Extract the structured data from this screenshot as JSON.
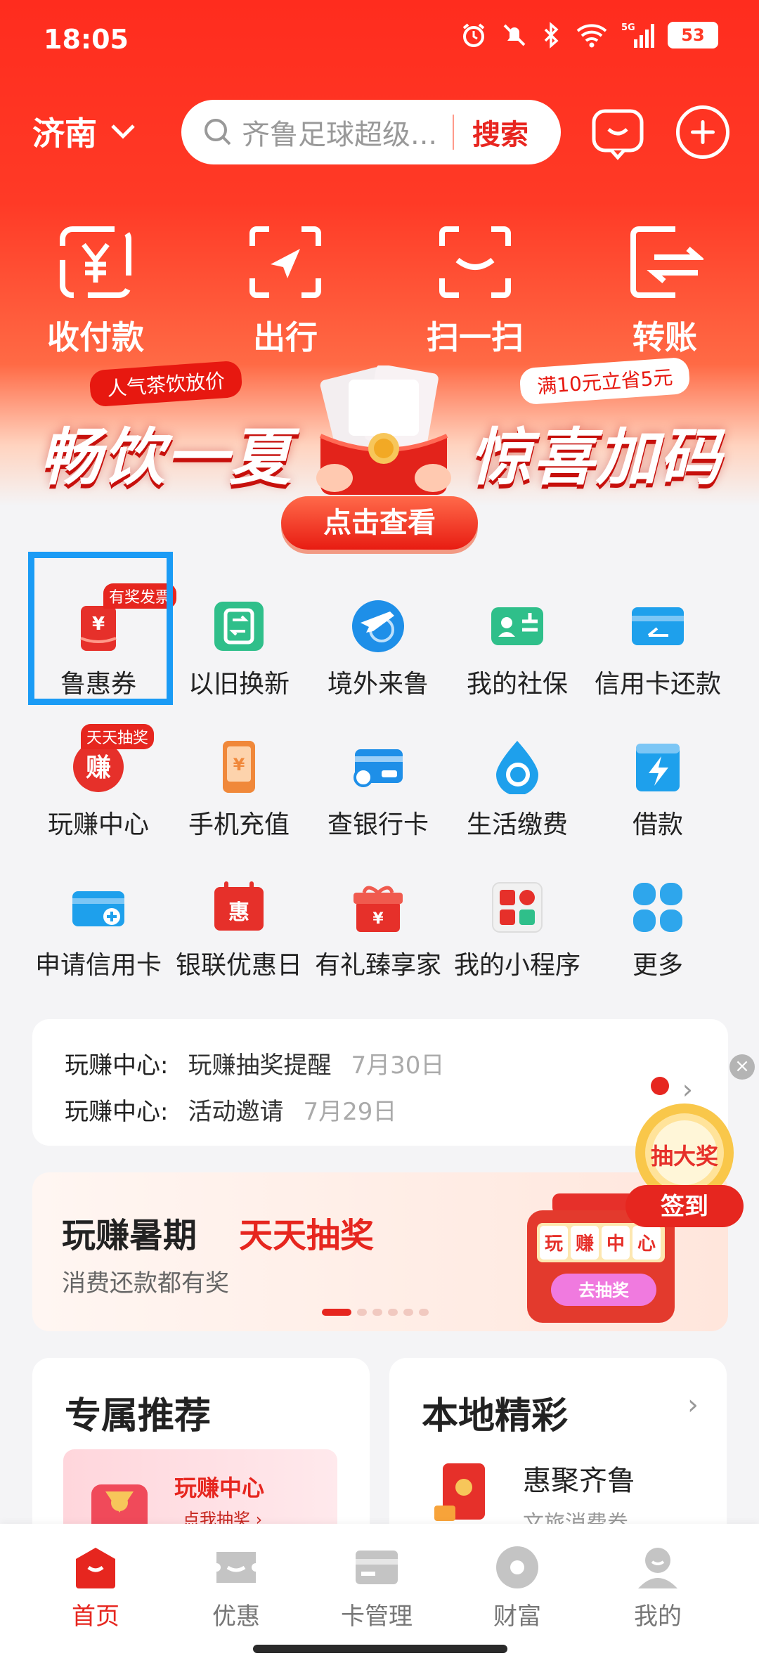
{
  "status_bar": {
    "time": "18:05",
    "network": "5G",
    "battery": "53"
  },
  "header": {
    "city": "济南",
    "search_placeholder": "齐鲁足球超级...",
    "search_button": "搜索"
  },
  "quick_actions": [
    {
      "label": "收付款",
      "icon": "yuan-scan-icon"
    },
    {
      "label": "出行",
      "icon": "navigation-arrow-icon"
    },
    {
      "label": "扫一扫",
      "icon": "scan-icon"
    },
    {
      "label": "转账",
      "icon": "transfer-icon"
    }
  ],
  "banner": {
    "tag_left": "人气茶饮放价",
    "title_left": "畅饮一夏",
    "tag_right": "满10元立省5元",
    "title_right": "惊喜加码",
    "cta": "点击查看"
  },
  "services": [
    {
      "label": "鲁惠券",
      "badge": "有奖发票",
      "icon": "coupon-icon",
      "color": "#e6302a"
    },
    {
      "label": "以旧换新",
      "badge": "",
      "icon": "exchange-icon",
      "color": "#2fbf8a"
    },
    {
      "label": "境外来鲁",
      "badge": "",
      "icon": "plane-globe-icon",
      "color": "#1e8fe8"
    },
    {
      "label": "我的社保",
      "badge": "",
      "icon": "id-card-icon",
      "color": "#2fbf8a"
    },
    {
      "label": "信用卡还款",
      "badge": "",
      "icon": "credit-card-icon",
      "color": "#1ea0ec"
    },
    {
      "label": "玩赚中心",
      "badge": "天天抽奖",
      "icon": "earn-icon",
      "color": "#e6302a"
    },
    {
      "label": "手机充值",
      "badge": "",
      "icon": "phone-topup-icon",
      "color": "#f0883a"
    },
    {
      "label": "查银行卡",
      "badge": "",
      "icon": "bank-card-icon",
      "color": "#1e8fe8"
    },
    {
      "label": "生活缴费",
      "badge": "",
      "icon": "water-drop-icon",
      "color": "#1ea0ec"
    },
    {
      "label": "借款",
      "badge": "",
      "icon": "lightning-icon",
      "color": "#1ea0ec"
    },
    {
      "label": "申请信用卡",
      "badge": "",
      "icon": "apply-card-icon",
      "color": "#1ea0ec"
    },
    {
      "label": "银联优惠日",
      "badge": "",
      "icon": "calendar-icon",
      "color": "#e6302a"
    },
    {
      "label": "有礼臻享家",
      "badge": "",
      "icon": "gift-icon",
      "color": "#e6302a"
    },
    {
      "label": "我的小程序",
      "badge": "",
      "icon": "mini-program-icon",
      "color": "#e6302a"
    },
    {
      "label": "更多",
      "badge": "",
      "icon": "more-grid-icon",
      "color": "#2ea6ec"
    }
  ],
  "notices": [
    {
      "source": "玩赚中心:",
      "text": "玩赚抽奖提醒",
      "date": "7月30日"
    },
    {
      "source": "玩赚中心:",
      "text": "活动邀请",
      "date": "7月29日"
    }
  ],
  "promo": {
    "title": "玩赚暑期",
    "title_highlight": "天天抽奖",
    "subtitle": "消费还款都有奖",
    "slot_cells": [
      "玩",
      "赚",
      "中",
      "心"
    ],
    "slot_button": "去抽奖"
  },
  "floating": {
    "top": "抽大奖",
    "bottom": "签到"
  },
  "cards": {
    "recommend": {
      "title": "专属推荐",
      "tile_title": "玩赚中心",
      "tile_sub": "点我抽奖 ›"
    },
    "local": {
      "title": "本地精彩",
      "item_title": "惠聚齐鲁",
      "item_sub": "文旅消费券"
    }
  },
  "tabs": [
    {
      "label": "首页",
      "icon": "home-icon",
      "active": true
    },
    {
      "label": "优惠",
      "icon": "ticket-icon",
      "active": false
    },
    {
      "label": "卡管理",
      "icon": "card-icon",
      "active": false
    },
    {
      "label": "财富",
      "icon": "wealth-icon",
      "active": false
    },
    {
      "label": "我的",
      "icon": "profile-icon",
      "active": false
    }
  ]
}
